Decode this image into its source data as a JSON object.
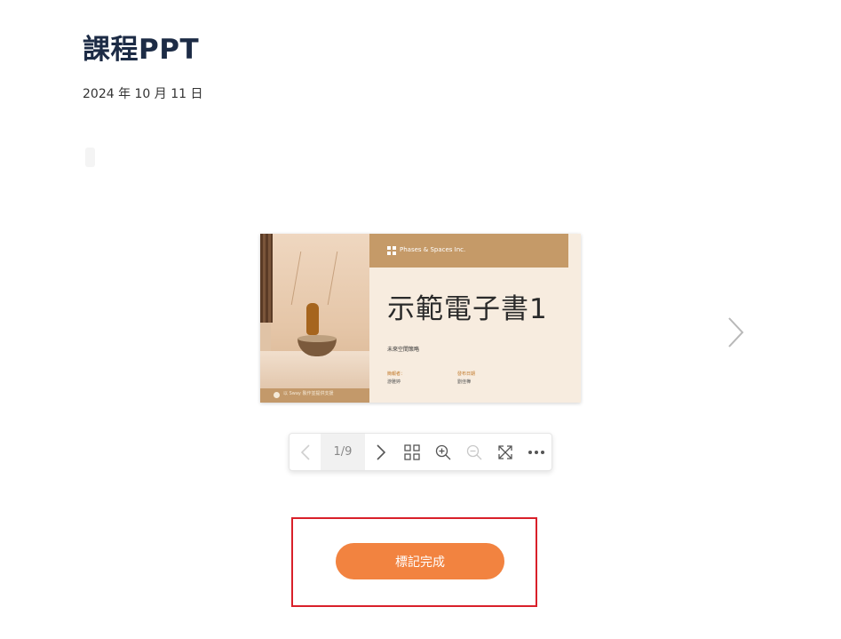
{
  "page": {
    "title": "課程PPT",
    "date": "2024 年 10 月 11 日"
  },
  "slide": {
    "brand": "Phases & Spaces Inc.",
    "heading": "示範電子書1",
    "subtitle": "未來空間策略",
    "meta": [
      {
        "key": "簡報者：",
        "value": "游雅婷"
      },
      {
        "key": "發布日期",
        "value": "劉佳樺"
      }
    ],
    "footer": "以 Sway 製作並提供支援"
  },
  "toolbar": {
    "page_indicator": "1/9",
    "icons": [
      "chevron-left-icon",
      "chevron-right-icon",
      "grid-icon",
      "zoom-in-icon",
      "zoom-out-icon",
      "fullscreen-icon",
      "more-icon"
    ]
  },
  "action": {
    "mark_complete_label": "標記完成"
  },
  "colors": {
    "accent": "#f28340",
    "highlight": "#d9202a",
    "title": "#1c2b45"
  }
}
